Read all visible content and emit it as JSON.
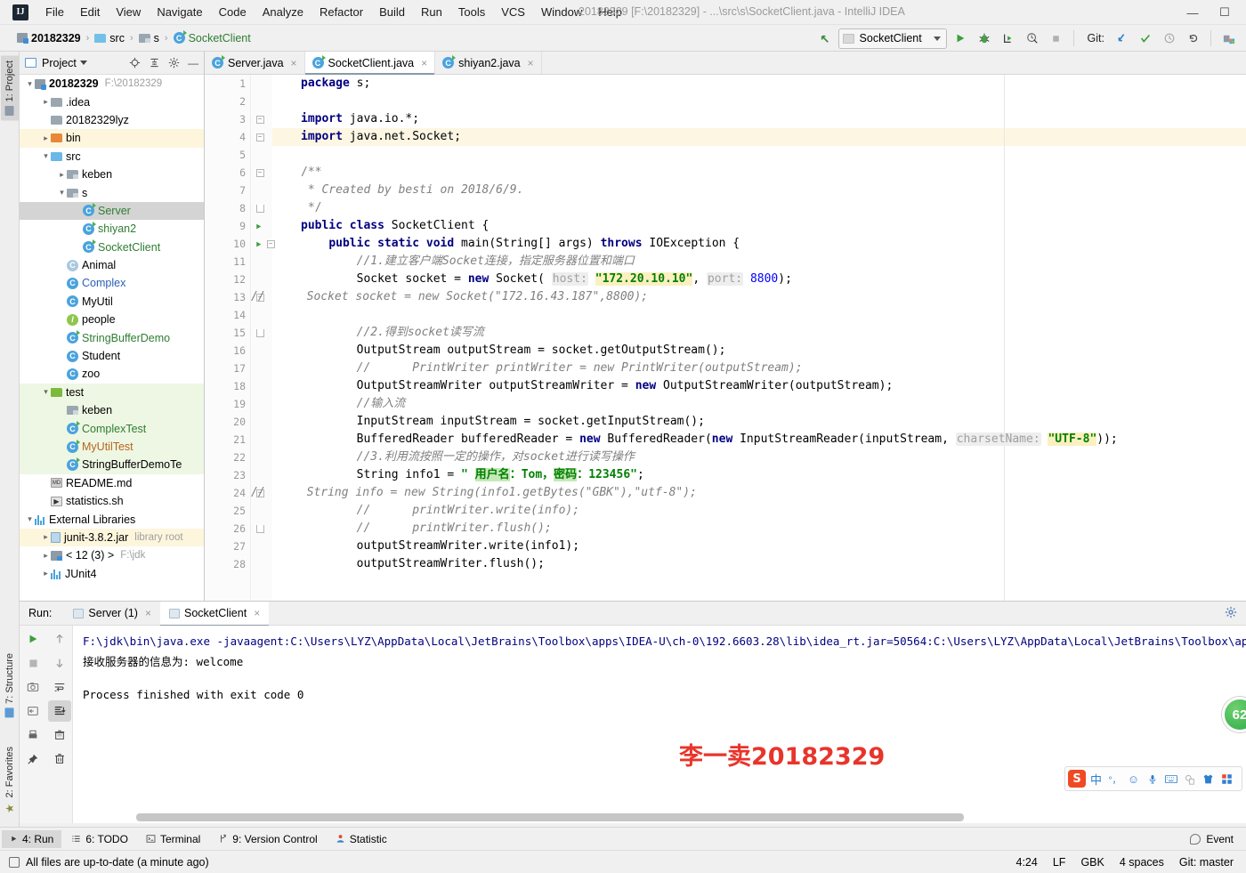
{
  "window": {
    "title": "20182329 [F:\\20182329] - ...\\src\\s\\SocketClient.java - IntelliJ IDEA",
    "logo": "IJ",
    "minimize": "—",
    "maximize": "☐"
  },
  "menubar": {
    "items": [
      {
        "label": "File",
        "mnemonic": "F"
      },
      {
        "label": "Edit",
        "mnemonic": "E"
      },
      {
        "label": "View",
        "mnemonic": "V"
      },
      {
        "label": "Navigate",
        "mnemonic": "N"
      },
      {
        "label": "Code",
        "mnemonic": "C"
      },
      {
        "label": "Analyze",
        "mnemonic": "A"
      },
      {
        "label": "Refactor",
        "mnemonic": "R"
      },
      {
        "label": "Build",
        "mnemonic": "B"
      },
      {
        "label": "Run",
        "mnemonic": "u"
      },
      {
        "label": "Tools",
        "mnemonic": "T"
      },
      {
        "label": "VCS",
        "mnemonic": "S"
      },
      {
        "label": "Window",
        "mnemonic": "W"
      },
      {
        "label": "Help",
        "mnemonic": "H"
      }
    ]
  },
  "breadcrumb": {
    "items": [
      {
        "label": "20182329",
        "icon": "module-icon"
      },
      {
        "label": "src",
        "icon": "source-folder-icon"
      },
      {
        "label": "s",
        "icon": "package-folder-icon"
      },
      {
        "label": "SocketClient",
        "icon": "java-class-icon"
      }
    ],
    "separator": "›"
  },
  "toolbar": {
    "back_arrow": "↖",
    "run_config_name": "SocketClient",
    "run_label": "Run",
    "debug_label": "Debug",
    "run_with_coverage_label": "Run with Coverage",
    "profile_label": "Profile",
    "stop_label": "Stop",
    "git_label": "Git:",
    "git_update_label": "Update Project",
    "git_commit_label": "Commit",
    "git_history_label": "History",
    "git_revert_label": "Revert",
    "settings_label": "Settings"
  },
  "left_strip": {
    "project": "1: Project",
    "structure": "7: Structure",
    "favorites": "2: Favorites"
  },
  "project_panel": {
    "title": "Project",
    "locate_icon": "crosshair-icon",
    "collapse_icon": "collapse-all-icon",
    "settings_icon": "gear-icon",
    "hide_icon": "minimize-icon",
    "tree": [
      {
        "label": "20182329",
        "dim": "F:\\20182329",
        "depth": 0,
        "arrow": "∨",
        "icon": "module-icon",
        "style": "bold",
        "state": "normal"
      },
      {
        "label": ".idea",
        "dim": "",
        "depth": 1,
        "arrow": "›",
        "icon": "folder-gray-icon",
        "style": "",
        "state": "normal"
      },
      {
        "label": "20182329lyz",
        "dim": "",
        "depth": 1,
        "arrow": "",
        "icon": "folder-gray-icon",
        "style": "",
        "state": "normal"
      },
      {
        "label": "bin",
        "dim": "",
        "depth": 1,
        "arrow": "›",
        "icon": "folder-orange-icon",
        "style": "",
        "state": "yellow"
      },
      {
        "label": "src",
        "dim": "",
        "depth": 1,
        "arrow": "∨",
        "icon": "folder-blue-icon",
        "style": "",
        "state": "normal"
      },
      {
        "label": "keben",
        "dim": "",
        "depth": 2,
        "arrow": "›",
        "icon": "package-folder-icon",
        "style": "",
        "state": "normal"
      },
      {
        "label": "s",
        "dim": "",
        "depth": 2,
        "arrow": "∨",
        "icon": "package-folder-icon",
        "style": "",
        "state": "normal"
      },
      {
        "label": "Server",
        "dim": "",
        "depth": 3,
        "arrow": "",
        "icon": "java-class-icon",
        "style": "green",
        "state": "selected"
      },
      {
        "label": "shiyan2",
        "dim": "",
        "depth": 3,
        "arrow": "",
        "icon": "java-class-icon",
        "style": "green",
        "state": "normal"
      },
      {
        "label": "SocketClient",
        "dim": "",
        "depth": 3,
        "arrow": "",
        "icon": "java-class-icon",
        "style": "green",
        "state": "normal"
      },
      {
        "label": "Animal",
        "dim": "",
        "depth": 2,
        "arrow": "",
        "icon": "abstract-class-icon",
        "style": "",
        "state": "normal"
      },
      {
        "label": "Complex",
        "dim": "",
        "depth": 2,
        "arrow": "",
        "icon": "class-icon",
        "style": "blue",
        "state": "normal"
      },
      {
        "label": "MyUtil",
        "dim": "",
        "depth": 2,
        "arrow": "",
        "icon": "class-icon",
        "style": "",
        "state": "normal"
      },
      {
        "label": "people",
        "dim": "",
        "depth": 2,
        "arrow": "",
        "icon": "interface-icon",
        "style": "",
        "state": "normal"
      },
      {
        "label": "StringBufferDemo",
        "dim": "",
        "depth": 2,
        "arrow": "",
        "icon": "java-class-icon",
        "style": "green",
        "state": "normal"
      },
      {
        "label": "Student",
        "dim": "",
        "depth": 2,
        "arrow": "",
        "icon": "class-icon",
        "style": "",
        "state": "normal"
      },
      {
        "label": "zoo",
        "dim": "",
        "depth": 2,
        "arrow": "",
        "icon": "class-icon",
        "style": "",
        "state": "normal"
      },
      {
        "label": "test",
        "dim": "",
        "depth": 1,
        "arrow": "∨",
        "icon": "folder-green-icon",
        "style": "",
        "state": "green"
      },
      {
        "label": "keben",
        "dim": "",
        "depth": 2,
        "arrow": "",
        "icon": "package-folder-icon",
        "style": "",
        "state": "green"
      },
      {
        "label": "ComplexTest",
        "dim": "",
        "depth": 2,
        "arrow": "",
        "icon": "java-class-icon",
        "style": "green",
        "state": "green"
      },
      {
        "label": "MyUtilTest",
        "dim": "",
        "depth": 2,
        "arrow": "",
        "icon": "java-class-icon",
        "style": "orange",
        "state": "green"
      },
      {
        "label": "StringBufferDemoTe",
        "dim": "",
        "depth": 2,
        "arrow": "",
        "icon": "java-class-icon",
        "style": "",
        "state": "green"
      },
      {
        "label": "README.md",
        "dim": "",
        "depth": 1,
        "arrow": "",
        "icon": "markdown-icon",
        "style": "",
        "state": "normal"
      },
      {
        "label": "statistics.sh",
        "dim": "",
        "depth": 1,
        "arrow": "",
        "icon": "shell-script-icon",
        "style": "",
        "state": "normal"
      },
      {
        "label": "External Libraries",
        "dim": "",
        "depth": 0,
        "arrow": "∨",
        "icon": "library-icon",
        "style": "",
        "state": "normal"
      },
      {
        "label": "junit-3.8.2.jar",
        "dim": "library root",
        "depth": 1,
        "arrow": "›",
        "icon": "jar-icon",
        "style": "",
        "state": "yellow"
      },
      {
        "label": "< 12 (3) >",
        "dim": "F:\\jdk",
        "depth": 1,
        "arrow": "›",
        "icon": "jdk-icon",
        "style": "",
        "state": "normal"
      },
      {
        "label": "JUnit4",
        "dim": "",
        "depth": 1,
        "arrow": "›",
        "icon": "library-icon",
        "style": "",
        "state": "normal"
      }
    ]
  },
  "editor": {
    "tabs": [
      {
        "label": "Server.java",
        "active": false,
        "icon": "java-class-icon"
      },
      {
        "label": "SocketClient.java",
        "active": true,
        "icon": "java-class-icon"
      },
      {
        "label": "shiyan2.java",
        "active": false,
        "icon": "java-class-icon"
      }
    ],
    "close_glyph": "×",
    "first_line": 1,
    "highlight_line": 4,
    "lines": [
      {
        "n": 1,
        "html": "<span class=\"kw\">package</span> s;"
      },
      {
        "n": 2,
        "html": ""
      },
      {
        "n": 3,
        "html": "<span class=\"kw\">import</span> java.io.*;",
        "fold": "minus"
      },
      {
        "n": 4,
        "html": "<span class=\"kw\">import</span> java.net.Socket;",
        "fold": "minus"
      },
      {
        "n": 5,
        "html": ""
      },
      {
        "n": 6,
        "html": "<span class=\"cmt-n\">/**</span>",
        "fold": "minus"
      },
      {
        "n": 7,
        "html": "<span class=\"cmt\"> * Created by besti on 2018/6/9.</span>"
      },
      {
        "n": 8,
        "html": "<span class=\"cmt-n\"> */</span>",
        "fold": "end"
      },
      {
        "n": 9,
        "html": "<span class=\"kw\">public class</span> SocketClient {",
        "run": true
      },
      {
        "n": 10,
        "html": "    <span class=\"kw\">public static void</span> main(String[] args) <span class=\"kw\">throws</span> IOException {",
        "run": true,
        "fold": "minus"
      },
      {
        "n": 11,
        "html": "        <span class=\"cmt\">//1.建立客户端Socket连接，指定服务器位置和端口</span>"
      },
      {
        "n": 12,
        "html": "        Socket socket = <span class=\"kw\">new</span> Socket( <span class=\"param\">host:</span> <span class=\"str strhl\">\"172.20.10.10\"</span>, <span class=\"param\">port:</span> <span class=\"num\">8800</span>);"
      },
      {
        "n": 13,
        "html": "<span class=\"cmt\">//      Socket socket = new Socket(\"172.16.43.187\",8800);</span>",
        "fold": "minus",
        "indent": -56
      },
      {
        "n": 14,
        "html": ""
      },
      {
        "n": 15,
        "html": "        <span class=\"cmt\">//2.得到socket读写流</span>",
        "fold": "end"
      },
      {
        "n": 16,
        "html": "        OutputStream outputStream = socket.getOutputStream();"
      },
      {
        "n": 17,
        "html": "        <span class=\"cmt\">//      PrintWriter printWriter = new PrintWriter(outputStream);</span>"
      },
      {
        "n": 18,
        "html": "        OutputStreamWriter outputStreamWriter = <span class=\"kw\">new</span> OutputStreamWriter(outputStream);"
      },
      {
        "n": 19,
        "html": "        <span class=\"cmt\">//输入流</span>"
      },
      {
        "n": 20,
        "html": "        InputStream inputStream = socket.getInputStream();"
      },
      {
        "n": 21,
        "html": "        BufferedReader bufferedReader = <span class=\"kw\">new</span> BufferedReader(<span class=\"kw\">new</span> InputStreamReader(inputStream, <span class=\"param\">charsetName:</span> <span class=\"str strhl\">\"UTF-8\"</span>));"
      },
      {
        "n": 22,
        "html": "        <span class=\"cmt\">//3.利用流按照一定的操作，对socket进行读写操作</span>"
      },
      {
        "n": 23,
        "html": "        String info1 = <span class=\"str\">\" </span><span class=\"str grn-hl\">用户名</span><span class=\"str\">：Tom，</span><span class=\"str grn-hl\">密码</span><span class=\"str\">：123456\"</span>;"
      },
      {
        "n": 24,
        "html": "<span class=\"cmt\">//      String info = new String(info1.getBytes(\"GBK\"),\"utf-8\");</span>",
        "fold": "minus",
        "indent": -56
      },
      {
        "n": 25,
        "html": "        <span class=\"cmt\">//      printWriter.write(info);</span>"
      },
      {
        "n": 26,
        "html": "        <span class=\"cmt\">//      printWriter.flush();</span>",
        "fold": "end"
      },
      {
        "n": 27,
        "html": "        outputStreamWriter.write(info1);"
      },
      {
        "n": 28,
        "html": "        outputStreamWriter.flush();"
      }
    ]
  },
  "run_panel": {
    "label": "Run:",
    "tabs": [
      {
        "label": "Server (1)",
        "active": false,
        "closable": true
      },
      {
        "label": "SocketClient",
        "active": true,
        "closable": true
      }
    ],
    "gear_icon": "gear-icon",
    "toolbar_left": [
      "rerun-icon",
      "stop-icon",
      "screenshot-icon",
      "export-icon",
      "print-icon",
      "pin-icon"
    ],
    "toolbar_right": [
      "up-icon",
      "down-icon",
      "soft-wrap-icon",
      "scroll-to-end-icon",
      "clear-all-icon",
      "delete-icon"
    ],
    "console": [
      {
        "text": "F:\\jdk\\bin\\java.exe -javaagent:C:\\Users\\LYZ\\AppData\\Local\\JetBrains\\Toolbox\\apps\\IDEA-U\\ch-0\\192.6603.28\\lib\\idea_rt.jar=50564:C:\\Users\\LYZ\\AppData\\Local\\JetBrains\\Toolbox\\apps\\IDEA-U\\ch",
        "color": "blue"
      },
      {
        "text": "接收服务器的信息为: welcome",
        "color": "black"
      },
      {
        "text": "",
        "color": "black"
      },
      {
        "text": "Process finished with exit code 0",
        "color": "black"
      }
    ],
    "watermark": "李一卖20182329"
  },
  "ime_bar": {
    "logo": "S",
    "mode": "中",
    "punctuation": "°，",
    "emoji": "smiley-icon",
    "voice": "microphone-icon",
    "keyboard": "keyboard-icon",
    "screenshot": "screenshot-icon",
    "skin": "skin-icon",
    "toolbox": "toolbox-icon"
  },
  "badge": {
    "value": "62"
  },
  "bottom_bar": {
    "items": [
      {
        "label": "4: Run",
        "mnemonic": "4",
        "icon": "play-icon",
        "active": true
      },
      {
        "label": "6: TODO",
        "mnemonic": "6",
        "icon": "todo-icon",
        "active": false
      },
      {
        "label": "Terminal",
        "mnemonic": "",
        "icon": "terminal-icon",
        "active": false
      },
      {
        "label": "9: Version Control",
        "mnemonic": "9",
        "icon": "branch-icon",
        "active": false
      },
      {
        "label": "Statistic",
        "mnemonic": "",
        "icon": "statistic-icon",
        "active": false
      }
    ],
    "event_label": "Event"
  },
  "status_bar": {
    "message": "All files are up-to-date (a minute ago)",
    "caret": "4:24",
    "line_separator": "LF",
    "encoding": "GBK",
    "indent": "4 spaces",
    "branch": "Git: master"
  }
}
